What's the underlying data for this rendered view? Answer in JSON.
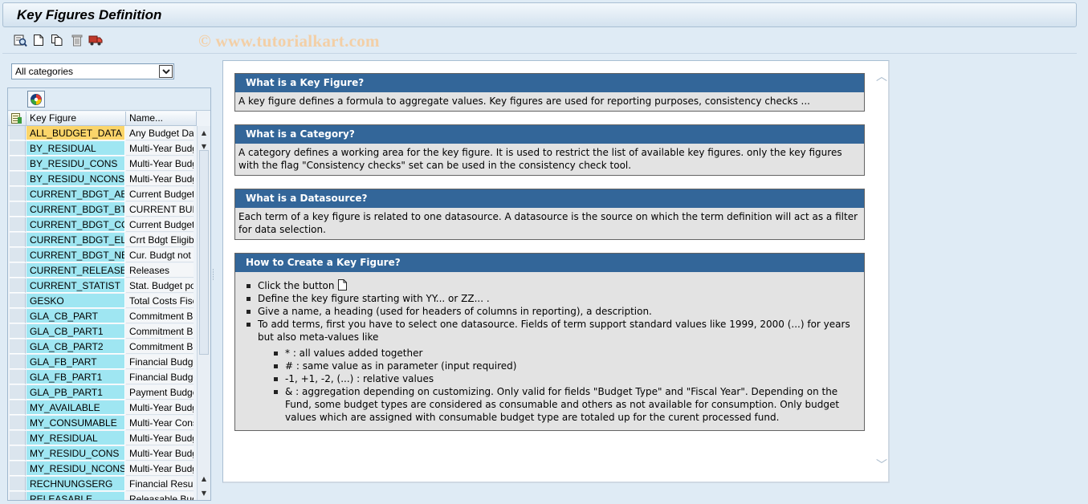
{
  "window": {
    "title": "Key Figures Definition"
  },
  "toolbar": {
    "watermark": "© www.tutorialkart.com",
    "buttons": [
      "display-icon",
      "create-icon",
      "copy-icon",
      "delete-icon",
      "transport-icon"
    ]
  },
  "category_select": {
    "value": "All categories"
  },
  "grid": {
    "headers": {
      "key_figure": "Key Figure",
      "name": "Name..."
    },
    "rows": [
      {
        "key": "ALL_BUDGET_DATA",
        "name": "Any Budget Data"
      },
      {
        "key": "BY_RESIDUAL",
        "name": "Multi-Year Budget"
      },
      {
        "key": "BY_RESIDU_CONS",
        "name": "Multi-Year Budget"
      },
      {
        "key": "BY_RESIDU_NCONS",
        "name": "Multi-Year Budget"
      },
      {
        "key": "CURRENT_BDGT_AB",
        "name": "Current Budget"
      },
      {
        "key": "CURRENT_BDGT_BT",
        "name": "CURRENT BUDGET"
      },
      {
        "key": "CURRENT_BDGT_CO",
        "name": "Current Budget"
      },
      {
        "key": "CURRENT_BDGT_EL",
        "name": "Crrt Bdgt Eligible"
      },
      {
        "key": "CURRENT_BDGT_NE",
        "name": "Cur. Budgt not"
      },
      {
        "key": "CURRENT_RELEASE",
        "name": "Releases"
      },
      {
        "key": "CURRENT_STATIST",
        "name": "Stat. Budget pos"
      },
      {
        "key": "GESKO",
        "name": "Total Costs Fiscal"
      },
      {
        "key": "GLA_CB_PART",
        "name": "Commitment Budget"
      },
      {
        "key": "GLA_CB_PART1",
        "name": "Commitment Budget"
      },
      {
        "key": "GLA_CB_PART2",
        "name": "Commitment Budget"
      },
      {
        "key": "GLA_FB_PART",
        "name": "Financial Budget"
      },
      {
        "key": "GLA_FB_PART1",
        "name": "Financial Budget"
      },
      {
        "key": "GLA_PB_PART1",
        "name": "Payment Budget"
      },
      {
        "key": "MY_AVAILABLE",
        "name": "Multi-Year Budget"
      },
      {
        "key": "MY_CONSUMABLE",
        "name": "Multi-Year Cons"
      },
      {
        "key": "MY_RESIDUAL",
        "name": "Multi-Year Budget"
      },
      {
        "key": "MY_RESIDU_CONS",
        "name": "Multi-Year Budget"
      },
      {
        "key": "MY_RESIDU_NCONS",
        "name": "Multi-Year Budget"
      },
      {
        "key": "RECHNUNGSERG",
        "name": "Financial Result"
      },
      {
        "key": "RELEASABLE",
        "name": "Releasable Budget"
      }
    ]
  },
  "help": {
    "key_figure": {
      "title": "What is a Key Figure?",
      "text": "A key figure defines a formula to aggregate values. Key figures are used for reporting purposes, consistency checks ..."
    },
    "category": {
      "title": "What is a Category?",
      "text": "A category defines a working area for the key figure. It is used to restrict the list of available key figures. only the key figures with the flag \"Consistency checks\" set can be used in the consistency check tool."
    },
    "datasource": {
      "title": "What is a Datasource?",
      "text": "Each term of a key figure is related to one datasource. A datasource is the source on which the term definition will act as a filter for data selection."
    },
    "howto": {
      "title": "How to Create a Key Figure?",
      "step1": "Click the button",
      "step2": "Define the key figure starting with YY... or ZZ... .",
      "step3": "Give a name, a heading (used for headers of columns in reporting), a description.",
      "step4": "To add terms, first you have to select one datasource. Fields of term support standard values like 1999, 2000 (...) for years but also meta-values like",
      "sub1": "* : all values added together",
      "sub2": "# : same value as in parameter (input required)",
      "sub3": "-1, +1, -2, (...) : relative values",
      "sub4": "& : aggregation depending on customizing. Only valid for fields \"Budget Type\" and \"Fiscal Year\". Depending on the Fund, some budget types are considered as consumable and others as not available for consumption. Only budget values which are assigned with consumable budget type are totaled up for the curent processed fund."
    }
  }
}
